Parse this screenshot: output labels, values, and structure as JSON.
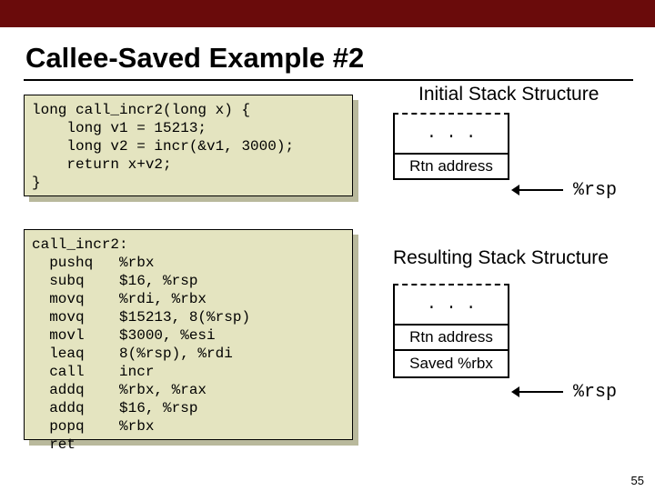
{
  "title": "Callee-Saved Example #2",
  "code1": "long call_incr2(long x) {\n    long v1 = 15213;\n    long v2 = incr(&v1, 3000);\n    return x+v2;\n}",
  "code2": "call_incr2:\n  pushq   %rbx\n  subq    $16, %rsp\n  movq    %rdi, %rbx\n  movq    $15213, 8(%rsp)\n  movl    $3000, %esi\n  leaq    8(%rsp), %rdi\n  call    incr\n  addq    %rbx, %rax\n  addq    $16, %rsp\n  popq    %rbx\n  ret",
  "heading_initial": "Initial Stack Structure",
  "heading_resulting": "Resulting Stack Structure",
  "stack1": {
    "dots": ". . .",
    "rtn": "Rtn address"
  },
  "stack2": {
    "dots": ". . .",
    "rtn": "Rtn address",
    "saved": "Saved %rbx"
  },
  "reg_rsp": "%rsp",
  "page_number": "55"
}
